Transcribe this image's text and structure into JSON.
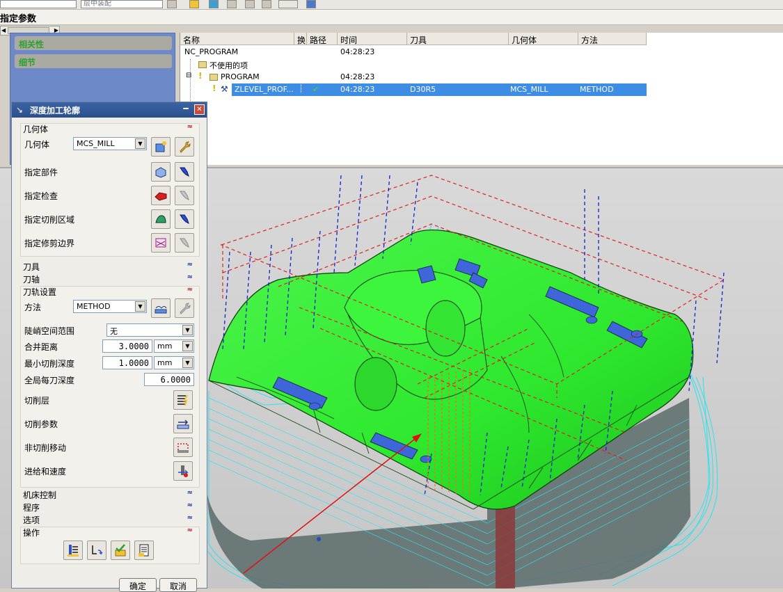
{
  "window": {
    "title": "指定参数"
  },
  "toolbar": {
    "combo_value": "层中装配"
  },
  "sidebar": {
    "items": [
      {
        "label": "相关性"
      },
      {
        "label": "细节"
      }
    ]
  },
  "navigator": {
    "columns": [
      "名称",
      "换",
      "路径",
      "时间",
      "刀具",
      "几何体",
      "方法"
    ],
    "rows": [
      {
        "name": "NC_PROGRAM",
        "time": "04:28:23",
        "tool": "",
        "geometry": "",
        "method": ""
      },
      {
        "name": "不使用的项",
        "time": "",
        "tool": "",
        "geometry": "",
        "method": ""
      },
      {
        "name": "PROGRAM",
        "time": "04:28:23",
        "tool": "",
        "geometry": "",
        "method": ""
      },
      {
        "name": "ZLEVEL_PROF...",
        "time": "04:28:23",
        "tool": "D30R5",
        "geometry": "MCS_MILL",
        "method": "METHOD",
        "path_status": "✔"
      }
    ]
  },
  "dialog": {
    "title": "深度加工轮廓",
    "geometry_section": {
      "header": "几何体",
      "geometry_label": "几何体",
      "geometry_value": "MCS_MILL",
      "specify_part": "指定部件",
      "specify_check": "指定检查",
      "specify_cut_area": "指定切削区域",
      "specify_trim": "指定修剪边界"
    },
    "tool_section": "刀具",
    "axis_section": "刀轴",
    "path_section": {
      "header": "刀轨设置",
      "method_label": "方法",
      "method_value": "METHOD",
      "steep_label": "陡峭空间范围",
      "steep_value": "无",
      "merge_label": "合并距离",
      "merge_value": "3.0000",
      "merge_unit": "mm",
      "min_depth_label": "最小切削深度",
      "min_depth_value": "1.0000",
      "min_depth_unit": "mm",
      "global_depth_label": "全局每刀深度",
      "global_depth_value": "6.0000",
      "cut_levels": "切削层",
      "cut_params": "切削参数",
      "non_cut": "非切削移动",
      "feeds": "进给和速度"
    },
    "machine_section": "机床控制",
    "program_section": "程序",
    "options_section": "选项",
    "operation_section": "操作",
    "ok_label": "确定",
    "cancel_label": "取消"
  },
  "colors": {
    "model_green": "#2ee82e",
    "pocket_blue": "#3f66d8",
    "path_cyan": "#28e4f0",
    "path_red": "#e02020",
    "path_blue": "#1020d0",
    "accent_selected": "#3d8de4"
  }
}
